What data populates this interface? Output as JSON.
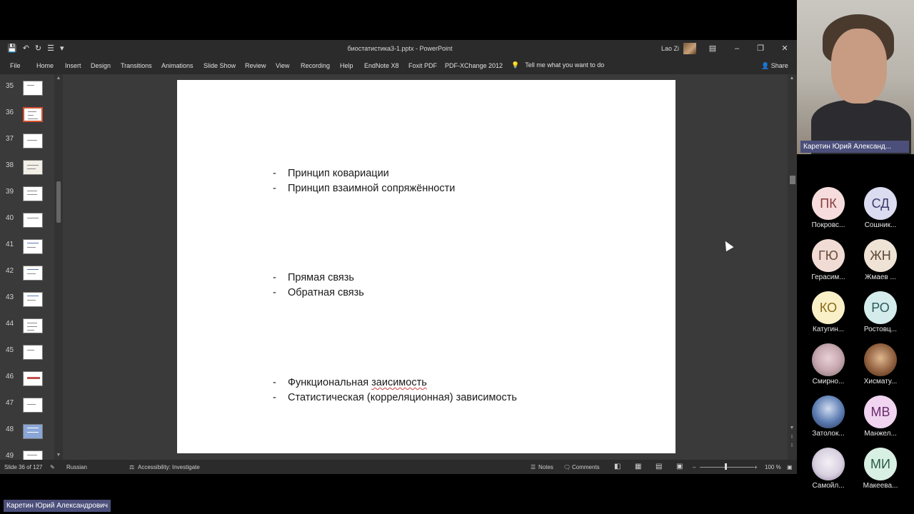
{
  "window": {
    "title": "биостатистика3-1.pptx  -  PowerPoint",
    "user": "Lao Zi",
    "qat": [
      "save-icon",
      "undo-icon",
      "redo-icon",
      "touch-icon",
      "customize-icon"
    ]
  },
  "ribbon": {
    "tabs": [
      "File",
      "Home",
      "Insert",
      "Design",
      "Transitions",
      "Animations",
      "Slide Show",
      "Review",
      "View",
      "Recording",
      "Help",
      "EndNote X8",
      "Foxit PDF",
      "PDF-XChange 2012"
    ],
    "tell_me": "Tell me what you want to do",
    "share": "Share"
  },
  "thumbnails": [
    "35",
    "36",
    "37",
    "38",
    "39",
    "40",
    "41",
    "42",
    "43",
    "44",
    "45",
    "46",
    "47",
    "48",
    "49"
  ],
  "selected_slide": "36",
  "slide": {
    "dash": "-",
    "group1": [
      "Принцип ковариации",
      "Принцип взаимной сопряжённости"
    ],
    "group2": [
      "Прямая связь",
      "Обратная связь"
    ],
    "group3_line1_a": "Функциональная ",
    "group3_line1_b": "заисимость",
    "group3_line2": "Статистическая (корреляционная) зависимость"
  },
  "status": {
    "slide_info": "Slide 36 of 127",
    "language": "Russian",
    "accessibility": "Accessibility: Investigate",
    "notes": "Notes",
    "comments": "Comments",
    "zoom": "100 %"
  },
  "meeting": {
    "speaker": "Каретин Юрий Александ...",
    "speaker_full": "Каретин Юрий Александрович",
    "participants": [
      {
        "initials": "ПК",
        "name": "Покровс...",
        "color": "#f6dcdc",
        "fg": "#8a3a3a"
      },
      {
        "initials": "СД",
        "name": "Сошник...",
        "color": "#dcdcf0",
        "fg": "#3a3a6a"
      },
      {
        "initials": "ГЮ",
        "name": "Герасим...",
        "color": "#f0dcd4",
        "fg": "#6a4a3a"
      },
      {
        "initials": "ЖН",
        "name": "Жмаев ...",
        "color": "#efe3d5",
        "fg": "#5a4535"
      },
      {
        "initials": "КО",
        "name": "Катугин...",
        "color": "#faf0c8",
        "fg": "#8a6a1a"
      },
      {
        "initials": "РО",
        "name": "Ростовц...",
        "color": "#d4ecec",
        "fg": "#2a5a5a"
      },
      {
        "initials": "",
        "name": "Смирно...",
        "color": "#c8a8b0",
        "fg": "#333"
      },
      {
        "initials": "",
        "name": "Хисмату...",
        "color": "#8a5a3a",
        "fg": "#333"
      },
      {
        "initials": "",
        "name": "Затолок...",
        "color": "#5a7ab0",
        "fg": "#333"
      },
      {
        "initials": "МВ",
        "name": "Манжел...",
        "color": "#f0d4f0",
        "fg": "#6a2a6a"
      },
      {
        "initials": "",
        "name": "Самойл...",
        "color": "#d8d0e0",
        "fg": "#333"
      },
      {
        "initials": "МИ",
        "name": "Макеева...",
        "color": "#d8f0e4",
        "fg": "#2a5a45"
      }
    ]
  }
}
